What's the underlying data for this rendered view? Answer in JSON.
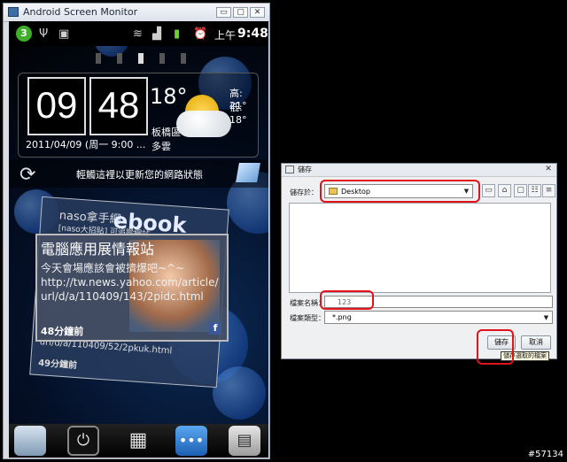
{
  "asm_window": {
    "title": "Android Screen Monitor",
    "buttons": {
      "minimize": "▭",
      "maximize": "▢",
      "close": "✕"
    }
  },
  "phone": {
    "status_bar": {
      "badge": "3",
      "ampm": "上午",
      "time": "9:48",
      "icons": [
        "usb-icon",
        "android-debug-icon",
        "wifi-icon",
        "signal-icon",
        "battery-icon",
        "alarm-icon"
      ]
    },
    "clock_widget": {
      "hour": "09",
      "minute": "48",
      "temperature": "18°",
      "high": "高: 21°",
      "low": "低: 18°",
      "location": "板橋區",
      "condition": "多雲",
      "date": "2011/04/09 (周一 9:00 ..."
    },
    "refresh_label": "輕觸這裡以更新您的網路狀態",
    "feed_back": {
      "logo": "ebook",
      "line1": "naso拿手網",
      "line2": "[naso大招貼] 可追蹤網站",
      "line3": "url/d/a/110409/52/2pkuk.html",
      "ago": "49分鐘前"
    },
    "feed_front": {
      "headline": "電腦應用展情報站",
      "subtitle": "今天會場應該會被擠爆吧~^~",
      "url_line1": "http://tw.news.yahoo.com/article/",
      "url_line2": "url/d/a/110409/143/2pidc.html",
      "ago": "48分鐘前",
      "fb": "f"
    },
    "dock": [
      "camera-icon",
      "power-icon",
      "app-drawer-icon",
      "messaging-icon",
      "apps-icon"
    ]
  },
  "save_dialog": {
    "title": "儲存",
    "save_in_label": "儲存於：",
    "save_in_value": "Desktop",
    "file_name_label": "檔案名稱：",
    "file_name_value": "123",
    "file_type_label": "檔案類型：",
    "file_type_value": "*.png",
    "save_button": "儲存",
    "cancel_button": "取消",
    "tooltip": "儲存選取的檔案",
    "toolbar": [
      "up-folder-icon",
      "home-icon",
      "new-folder-icon",
      "list-view-icon",
      "details-view-icon"
    ]
  },
  "watermark": "#57134",
  "colors": {
    "highlight": "#e2121a",
    "facebook": "#3b5998"
  }
}
